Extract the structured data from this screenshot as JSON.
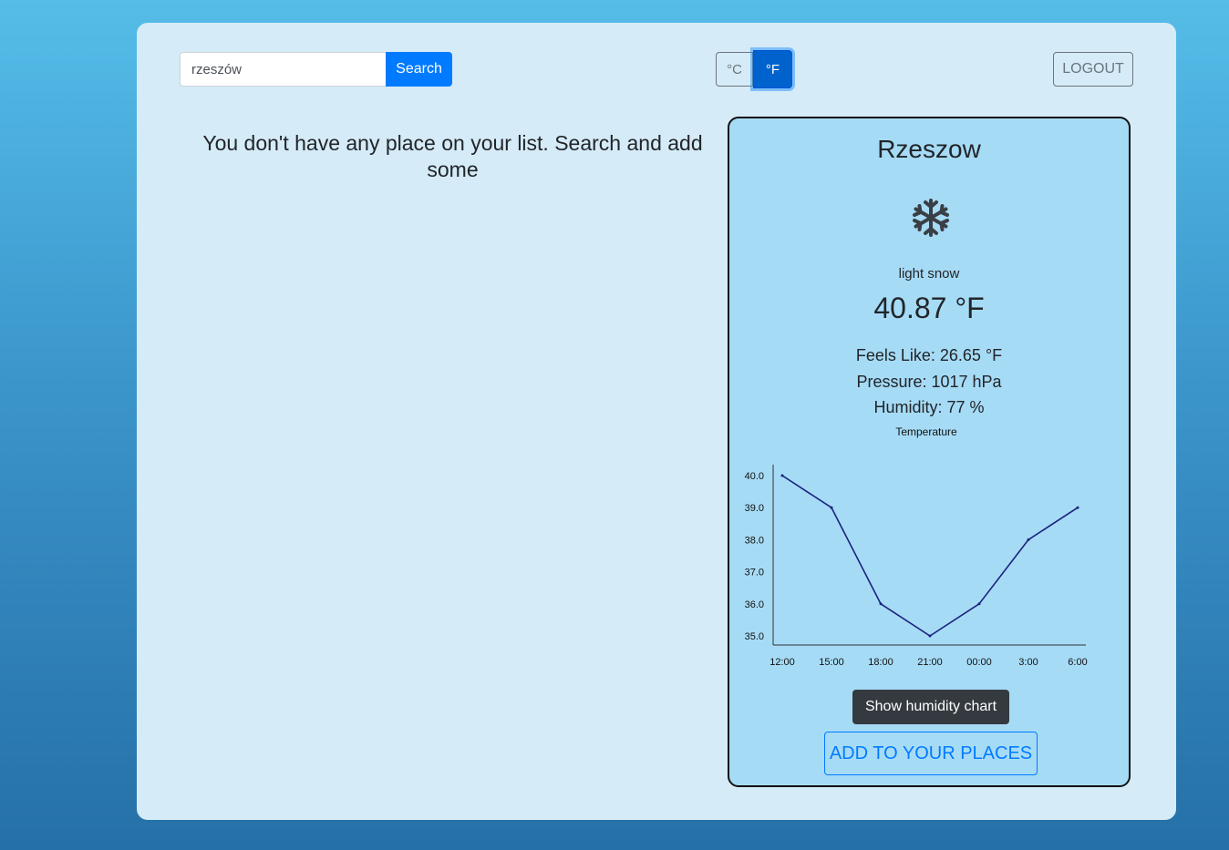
{
  "search": {
    "value": "rzeszów",
    "button_label": "Search"
  },
  "units": {
    "celsius_label": "°C",
    "fahrenheit_label": "°F",
    "selected": "°F"
  },
  "logout_label": "LOGOUT",
  "places": {
    "empty_message": "You don't have any place on your list. Search and add some"
  },
  "weather_card": {
    "city": "Rzeszow",
    "icon": "snowflake-icon",
    "description": "light snow",
    "temperature": "40.87 °F",
    "feels_like": "Feels Like: 26.65 °F",
    "pressure": "Pressure: 1017 hPa",
    "humidity": "Humidity: 77 %",
    "show_humidity_label": "Show humidity chart",
    "add_label": "ADD TO YOUR PLACES"
  },
  "chart_data": {
    "type": "line",
    "title": "Temperature",
    "categories": [
      "12:00",
      "15:00",
      "18:00",
      "21:00",
      "00:00",
      "3:00",
      "6:00"
    ],
    "values": [
      40.0,
      39.0,
      36.0,
      35.0,
      36.0,
      38.0,
      39.0
    ],
    "y_ticks": [
      "35.0",
      "36.0",
      "37.0",
      "38.0",
      "39.0",
      "40.0"
    ],
    "ylim": [
      35.0,
      40.0
    ],
    "line_color": "#1a237e",
    "grid": false
  },
  "colors": {
    "primary": "#007bff",
    "card_background": "#a6dbf6",
    "panel_background": "#d5ebf7"
  }
}
